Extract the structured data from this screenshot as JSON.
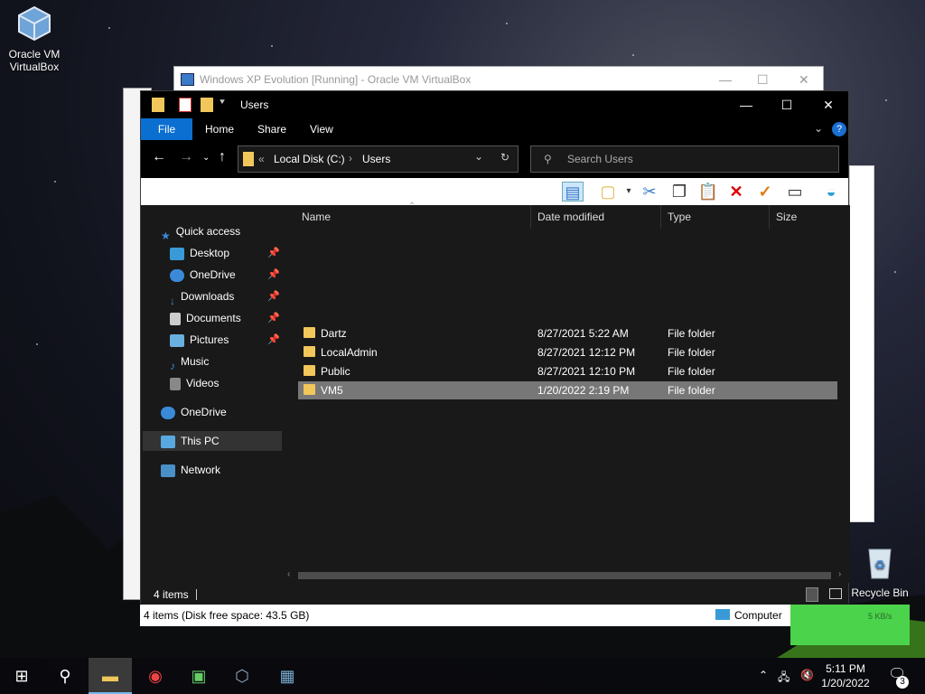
{
  "desktop": {
    "icons": [
      {
        "label": "Oracle VM VirtualBox"
      },
      {
        "label": "Recycle Bin"
      }
    ]
  },
  "background_window": {
    "title": "Windows XP Evolution [Running] - Oracle VM VirtualBox"
  },
  "explorer": {
    "title": "Users",
    "ribbon_tabs": [
      "File",
      "Home",
      "Share",
      "View"
    ],
    "address": {
      "overflow": "«",
      "segments": [
        "Local Disk (C:)",
        "Users"
      ]
    },
    "search_placeholder": "Search Users",
    "nav": {
      "quick_access": "Quick access",
      "items": [
        "Desktop",
        "OneDrive",
        "Downloads",
        "Documents",
        "Pictures",
        "Music",
        "Videos"
      ],
      "onedrive": "OneDrive",
      "this_pc": "This PC",
      "network": "Network"
    },
    "columns": [
      "Name",
      "Date modified",
      "Type",
      "Size"
    ],
    "rows": [
      {
        "name": "Dartz",
        "date": "8/27/2021 5:22 AM",
        "type": "File folder"
      },
      {
        "name": "LocalAdmin",
        "date": "8/27/2021 12:12 PM",
        "type": "File folder"
      },
      {
        "name": "Public",
        "date": "8/27/2021 12:10 PM",
        "type": "File folder"
      },
      {
        "name": "VM5",
        "date": "1/20/2022 2:19 PM",
        "type": "File folder"
      }
    ],
    "status_items": "4 items",
    "status_detail": "4 items (Disk free space: 43.5 GB)",
    "status_location": "Computer"
  },
  "taskbar": {
    "time": "5:11 PM",
    "date": "1/20/2022",
    "notifications": "3",
    "green_panel_text": "5 KB/s"
  },
  "colors": {
    "accent": "#0a6fd0",
    "selected_row": "#777777",
    "folder": "#f1c75c"
  }
}
